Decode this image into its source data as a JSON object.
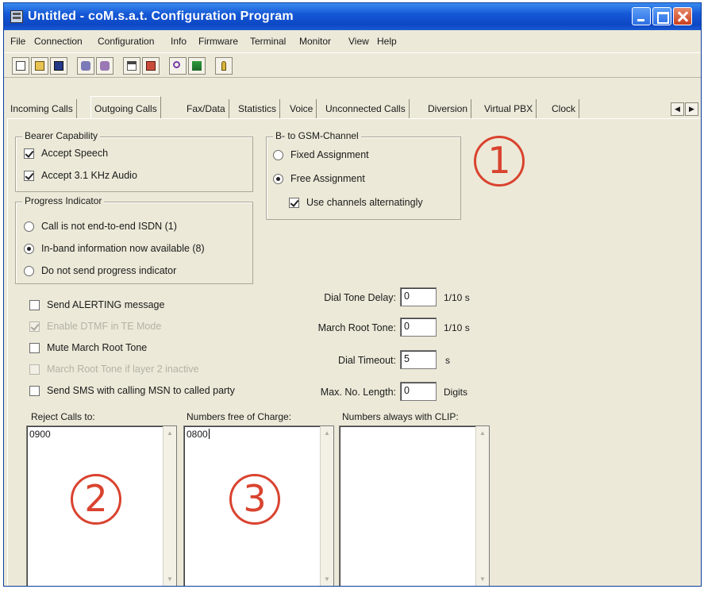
{
  "window": {
    "title": "Untitled - coM.s.a.t. Configuration Program"
  },
  "menu": [
    "File",
    "Connection",
    "Configuration",
    "Info",
    "Firmware",
    "Terminal",
    "Monitor",
    "View",
    "Help"
  ],
  "toolbar": {
    "icons": [
      "new-file-icon",
      "open-folder-icon",
      "save-disk-icon",
      "connect-icon",
      "disconnect-icon",
      "read-config-icon",
      "write-config-icon",
      "search-icon",
      "firmware-icon",
      "help-icon"
    ]
  },
  "tabs": [
    "Incoming Calls",
    "Outgoing Calls",
    "Fax/Data",
    "Statistics",
    "Voice",
    "Unconnected Calls",
    "Diversion",
    "Virtual PBX",
    "Clock"
  ],
  "active_tab": "Outgoing Calls",
  "bearer": {
    "title": "Bearer Capability",
    "accept_speech": "Accept Speech",
    "accept_audio": "Accept 3.1 KHz Audio"
  },
  "progress": {
    "title": "Progress Indicator",
    "opt1": "Call is not end-to-end ISDN (1)",
    "opt2": "In-band information now available (8)",
    "opt3": "Do not send progress indicator"
  },
  "channel": {
    "title": "B- to GSM-Channel",
    "fixed": "Fixed Assignment",
    "free": "Free Assignment",
    "alternate": "Use channels alternatingly"
  },
  "options": {
    "alerting": "Send ALERTING message",
    "dtmf": "Enable DTMF in TE Mode",
    "mute_root": "Mute March Root Tone",
    "march_layer2": "March Root Tone if layer 2 inactive",
    "send_sms": "Send SMS with calling MSN to called party"
  },
  "fields": {
    "dial_tone_delay": {
      "label": "Dial Tone Delay:",
      "value": "0",
      "unit": "1/10 s"
    },
    "march_root_tone": {
      "label": "March Root Tone:",
      "value": "0",
      "unit": "1/10 s"
    },
    "dial_timeout": {
      "label": "Dial Timeout:",
      "value": "5",
      "unit": "s"
    },
    "max_no_length": {
      "label": "Max. No. Length:",
      "value": "0",
      "unit": "Digits"
    }
  },
  "lists": {
    "reject": {
      "label": "Reject Calls to:",
      "value": "0900"
    },
    "free": {
      "label": "Numbers free of Charge:",
      "value": "0800"
    },
    "clip": {
      "label": "Numbers always with CLIP:",
      "value": ""
    }
  },
  "markers": {
    "m1": "1",
    "m2": "2",
    "m3": "3"
  },
  "colors": {
    "titlebar": "#1558d6",
    "window_bg": "#ece9d8",
    "marker": "#d9432f"
  }
}
